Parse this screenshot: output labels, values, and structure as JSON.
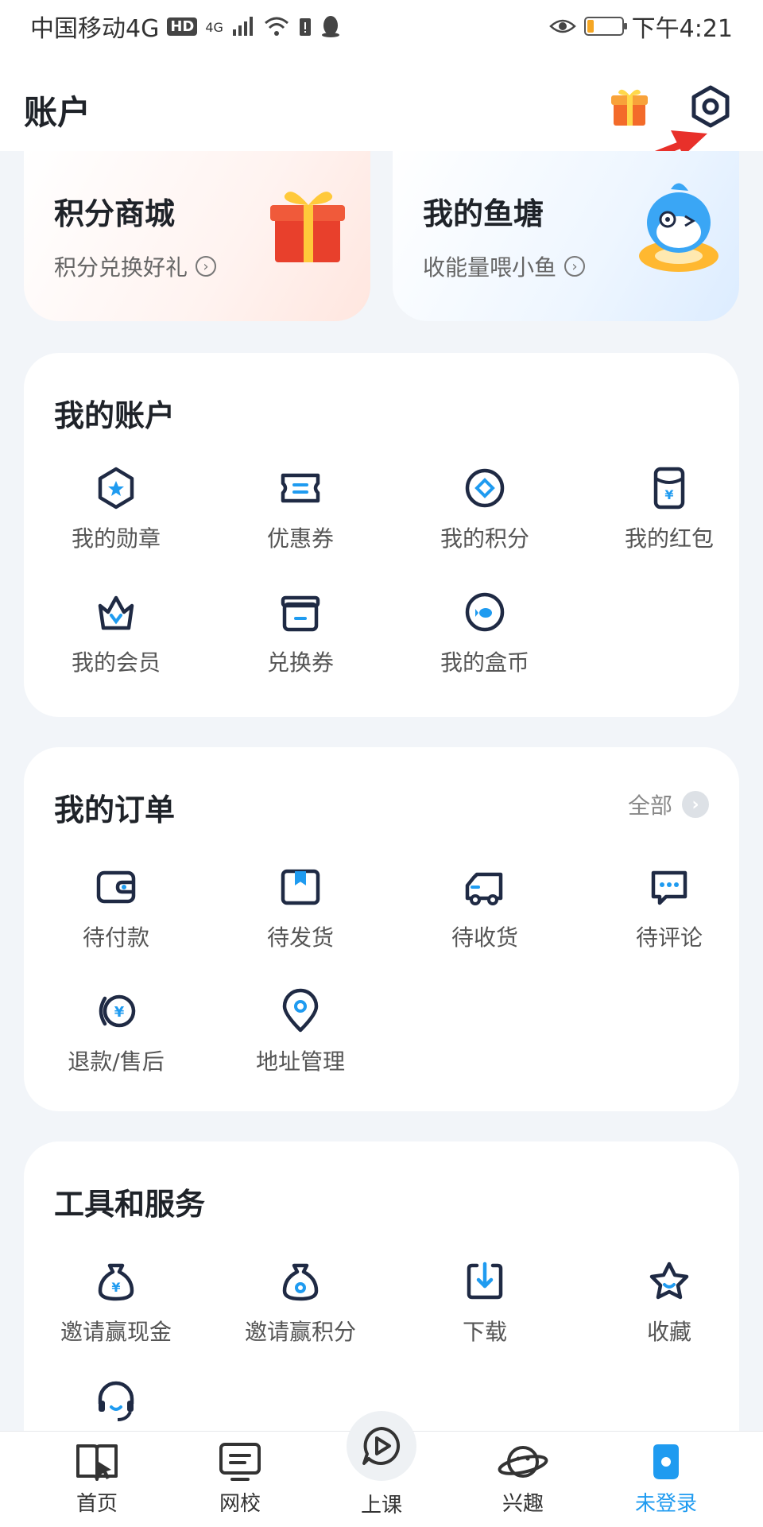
{
  "status_bar": {
    "carrier": "中国移动4G",
    "hd": "HD",
    "network": "4G",
    "time": "下午4:21",
    "battery_level": 0.2
  },
  "header": {
    "title": "账户",
    "gift_icon": "gift-icon",
    "settings_icon": "hexagon-settings-icon"
  },
  "promos": [
    {
      "title": "积分商城",
      "subtitle": "积分兑换好礼",
      "icon": "gift-box-icon"
    },
    {
      "title": "我的鱼塘",
      "subtitle": "收能量喂小鱼",
      "icon": "fish-mascot-icon"
    }
  ],
  "account": {
    "title": "我的账户",
    "items": [
      {
        "label": "我的勋章",
        "icon": "medal-icon"
      },
      {
        "label": "优惠券",
        "icon": "coupon-icon"
      },
      {
        "label": "我的积分",
        "icon": "points-icon"
      },
      {
        "label": "我的红包",
        "icon": "red-packet-icon"
      },
      {
        "label": "我的会员",
        "icon": "crown-icon"
      },
      {
        "label": "兑换券",
        "icon": "voucher-icon"
      },
      {
        "label": "我的盒币",
        "icon": "coin-icon"
      }
    ]
  },
  "orders": {
    "title": "我的订单",
    "more_label": "全部",
    "items": [
      {
        "label": "待付款",
        "icon": "wallet-icon"
      },
      {
        "label": "待发货",
        "icon": "package-icon"
      },
      {
        "label": "待收货",
        "icon": "truck-icon"
      },
      {
        "label": "待评论",
        "icon": "comment-icon"
      },
      {
        "label": "退款/售后",
        "icon": "refund-icon"
      },
      {
        "label": "地址管理",
        "icon": "location-icon"
      }
    ]
  },
  "tools": {
    "title": "工具和服务",
    "items": [
      {
        "label": "邀请赢现金",
        "icon": "money-bag-icon"
      },
      {
        "label": "邀请赢积分",
        "icon": "points-bag-icon"
      },
      {
        "label": "下载",
        "icon": "download-icon"
      },
      {
        "label": "收藏",
        "icon": "star-icon"
      },
      {
        "label": "",
        "icon": "headset-icon"
      }
    ]
  },
  "tab_bar": {
    "tabs": [
      {
        "label": "首页",
        "icon": "home-book-icon"
      },
      {
        "label": "网校",
        "icon": "monitor-icon"
      },
      {
        "label": "上课",
        "icon": "play-icon"
      },
      {
        "label": "兴趣",
        "icon": "planet-icon"
      },
      {
        "label": "未登录",
        "icon": "user-icon"
      }
    ],
    "active_index": 4
  },
  "colors": {
    "accent": "#1f9bf0",
    "icon_dark": "#1f2a44",
    "background": "#f2f5f9"
  }
}
